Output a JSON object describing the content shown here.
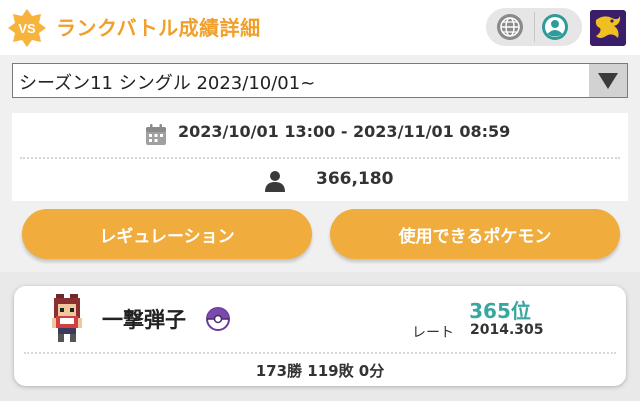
{
  "header": {
    "badge_text": "VS",
    "title": "ランクバトル成績詳細",
    "icons": {
      "language": "globe-icon",
      "account": "user-circle-icon",
      "game": "scarlet-violet-logo"
    }
  },
  "season_select": {
    "value": "シーズン11 シングル 2023/10/01~",
    "arrow_icon": "triangle-down-icon"
  },
  "season_info": {
    "date_range": "2023/10/01 13:00 - 2023/11/01 08:59",
    "player_count": "366,180",
    "icons": {
      "date": "calendar-icon",
      "players": "person-icon"
    }
  },
  "buttons": {
    "regulation": "レギュレーション",
    "usable_pokemon": "使用できるポケモン"
  },
  "player": {
    "name": "一撃弾子",
    "rank": "365位",
    "rate_label": "レート",
    "rate_value": "2014.305",
    "record": "173勝 119敗 0分"
  },
  "colors": {
    "accent": "#f0a02a",
    "button": "#f0ac3c",
    "rank": "#3aa6a0",
    "teal_icon": "#2f9a9a",
    "logo_bg": "#3a1e6a"
  }
}
